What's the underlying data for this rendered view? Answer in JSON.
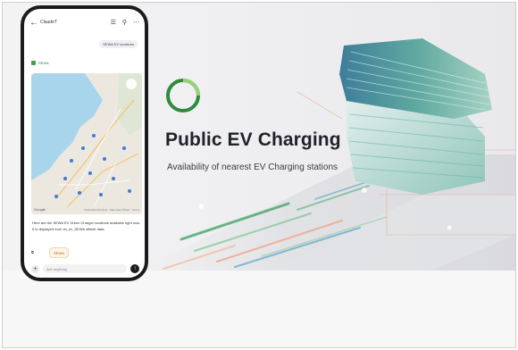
{
  "hero": {
    "title": "Public EV Charging",
    "subtitle": "Availability of nearest EV Charging stations"
  },
  "phone": {
    "header_title": "ClaudeT",
    "back_icon": "back-arrow-icon",
    "icons": [
      "menu-icon",
      "person-icon",
      "more-icon"
    ],
    "user_chip": "SEWA EV locations",
    "source_chip": "SEWA",
    "map_google_label": "Google",
    "map_attribution": "Keyboard shortcuts · Map data ©2024 · Terms",
    "answer_text": "Here are the SEWA EV Green Charger locations available right now. It is displayed from cb_ev_SEWA offside data.",
    "reply_chip": "SEWA",
    "input_placeholder": "Ask anything",
    "colors": {
      "frame": "#1b1b1b",
      "map_water": "#a8d5ec",
      "map_land": "#ece8e0",
      "accent_green": "#3ba34b"
    }
  },
  "colors": {
    "title": "#1f2329",
    "logo_green": "#2e8b3c",
    "building_teal": "#4fa9a0"
  }
}
